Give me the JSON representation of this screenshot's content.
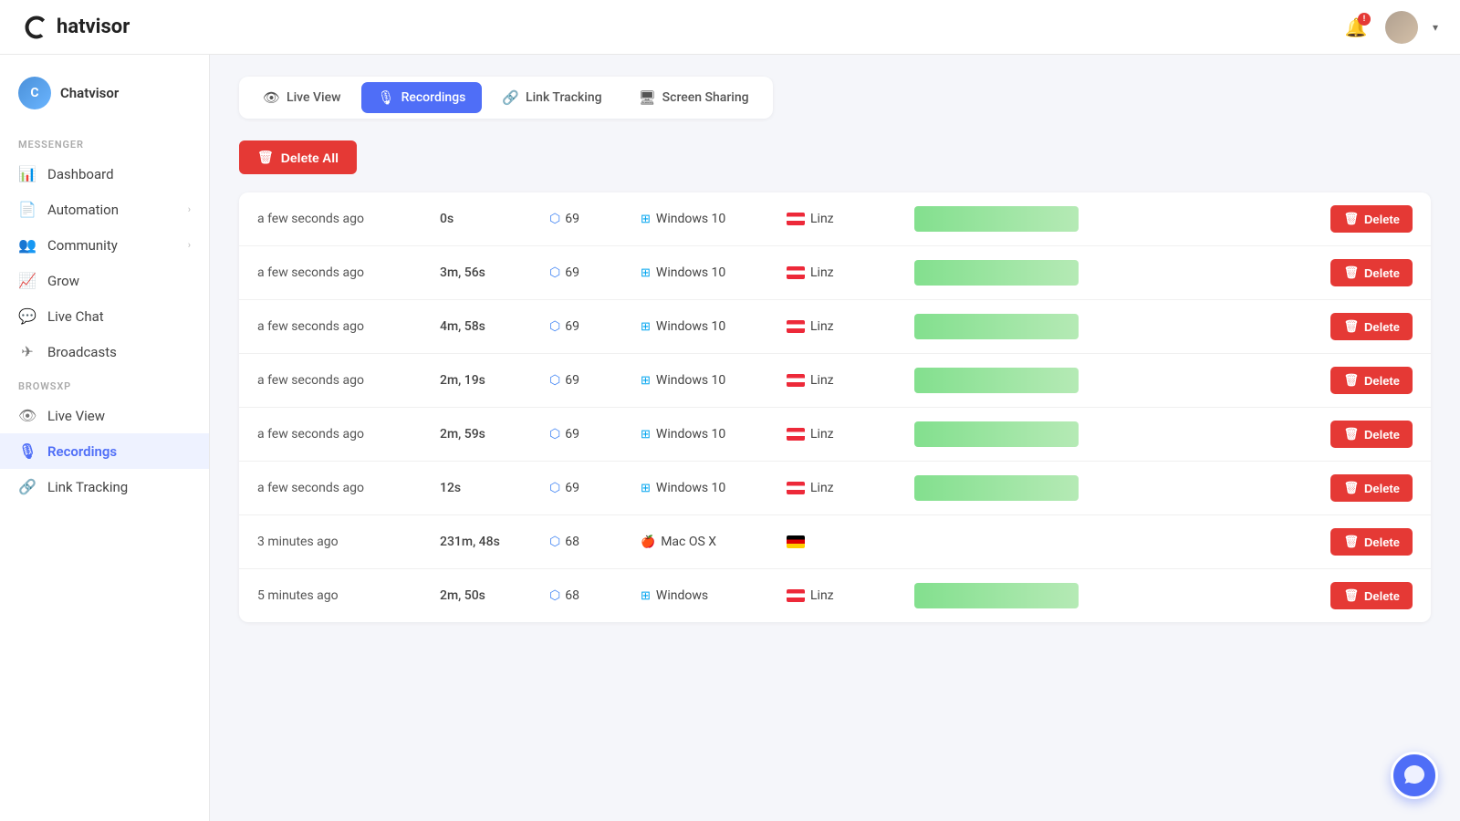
{
  "header": {
    "logo_text": "hatvisor",
    "notification_badge": "!",
    "user_chevron": "▾"
  },
  "sidebar": {
    "workspace_label": "Chatvisor",
    "workspace_initials": "C",
    "sections": [
      {
        "label": "MESSENGER",
        "items": [
          {
            "id": "dashboard",
            "label": "Dashboard",
            "icon": "📊",
            "active": false
          },
          {
            "id": "automation",
            "label": "Automation",
            "icon": "📄",
            "active": false,
            "chevron": true
          },
          {
            "id": "community",
            "label": "Community",
            "icon": "👥",
            "active": false,
            "chevron": true
          },
          {
            "id": "grow",
            "label": "Grow",
            "icon": "📈",
            "active": false
          },
          {
            "id": "live-chat",
            "label": "Live Chat",
            "icon": "💬",
            "active": false
          },
          {
            "id": "broadcasts",
            "label": "Broadcasts",
            "icon": "✈",
            "active": false
          }
        ]
      },
      {
        "label": "BROWSXP",
        "items": [
          {
            "id": "live-view",
            "label": "Live View",
            "icon": "👁",
            "active": false
          },
          {
            "id": "recordings",
            "label": "Recordings",
            "icon": "🎙",
            "active": true
          },
          {
            "id": "link-tracking",
            "label": "Link Tracking",
            "icon": "🔗",
            "active": false
          }
        ]
      }
    ]
  },
  "tabs": [
    {
      "id": "live-view",
      "label": "Live View",
      "icon": "👁",
      "active": false
    },
    {
      "id": "recordings",
      "label": "Recordings",
      "icon": "🎙",
      "active": true
    },
    {
      "id": "link-tracking",
      "label": "Link Tracking",
      "icon": "🔗",
      "active": false
    },
    {
      "id": "screen-sharing",
      "label": "Screen Sharing",
      "icon": "🖥",
      "active": false
    }
  ],
  "delete_all_label": "Delete All",
  "recordings": [
    {
      "timestamp": "a few seconds ago",
      "duration": "0s",
      "browser": "69",
      "os": "Windows 10",
      "location": "Linz",
      "flag": "austria",
      "has_bar": true
    },
    {
      "timestamp": "a few seconds ago",
      "duration": "3m, 56s",
      "browser": "69",
      "os": "Windows 10",
      "location": "Linz",
      "flag": "austria",
      "has_bar": true
    },
    {
      "timestamp": "a few seconds ago",
      "duration": "4m, 58s",
      "browser": "69",
      "os": "Windows 10",
      "location": "Linz",
      "flag": "austria",
      "has_bar": true
    },
    {
      "timestamp": "a few seconds ago",
      "duration": "2m, 19s",
      "browser": "69",
      "os": "Windows 10",
      "location": "Linz",
      "flag": "austria",
      "has_bar": true
    },
    {
      "timestamp": "a few seconds ago",
      "duration": "2m, 59s",
      "browser": "69",
      "os": "Windows 10",
      "location": "Linz",
      "flag": "austria",
      "has_bar": true
    },
    {
      "timestamp": "a few seconds ago",
      "duration": "12s",
      "browser": "69",
      "os": "Windows 10",
      "location": "Linz",
      "flag": "austria",
      "has_bar": true
    },
    {
      "timestamp": "3 minutes ago",
      "duration": "231m, 48s",
      "browser": "68",
      "os": "Mac OS X",
      "location": "",
      "flag": "germany",
      "has_bar": false
    },
    {
      "timestamp": "5 minutes ago",
      "duration": "2m, 50s",
      "browser": "68",
      "os": "Windows",
      "location": "Linz",
      "flag": "austria",
      "has_bar": true
    }
  ],
  "delete_label": "Delete",
  "colors": {
    "active_tab_bg": "#4f6ef7",
    "delete_btn_bg": "#e53935",
    "green_bar": "#6dda7a"
  }
}
